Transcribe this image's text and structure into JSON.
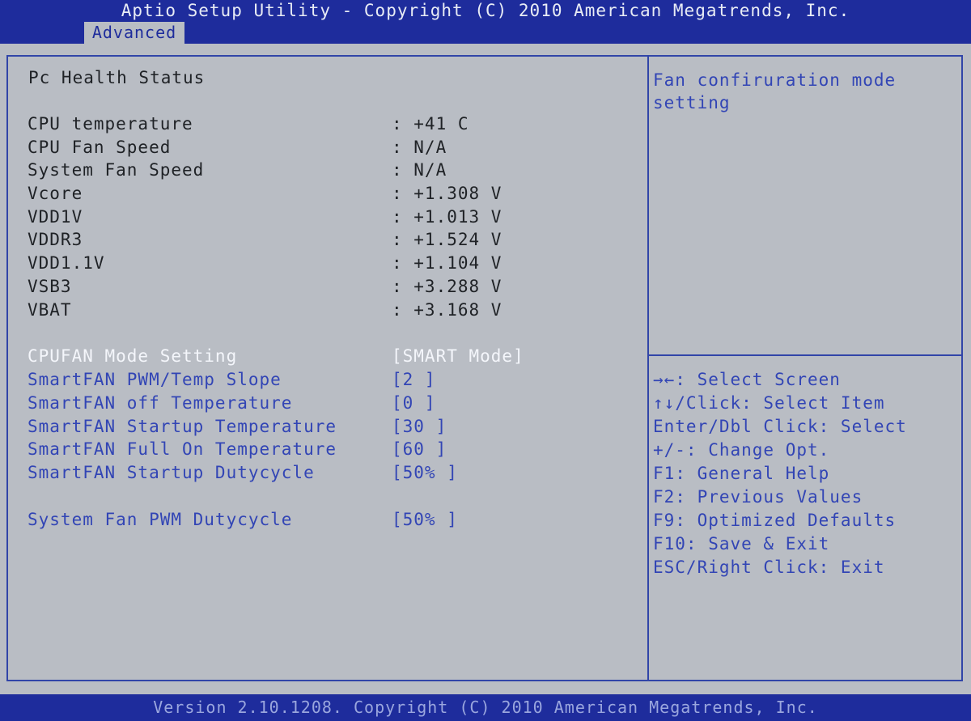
{
  "header": {
    "title": "Aptio Setup Utility - Copyright (C) 2010 American Megatrends, Inc.",
    "active_tab": "Advanced"
  },
  "main": {
    "section_title": "Pc Health Status",
    "readings": [
      {
        "label": "CPU temperature",
        "value": ": +41 C"
      },
      {
        "label": "CPU Fan Speed",
        "value": ": N/A"
      },
      {
        "label": "System Fan Speed",
        "value": ": N/A"
      },
      {
        "label": "Vcore",
        "value": ": +1.308 V"
      },
      {
        "label": "VDD1V",
        "value": ": +1.013 V"
      },
      {
        "label": "VDDR3",
        "value": ": +1.524 V"
      },
      {
        "label": "VDD1.1V",
        "value": ": +1.104 V"
      },
      {
        "label": "VSB3",
        "value": ": +3.288 V"
      },
      {
        "label": "VBAT",
        "value": ": +3.168 V"
      }
    ],
    "settings": [
      {
        "label": "CPUFAN Mode Setting",
        "value": "[SMART Mode]",
        "selected": true
      },
      {
        "label": "SmartFAN PWM/Temp Slope",
        "value": "[2 ]"
      },
      {
        "label": "SmartFAN off Temperature",
        "value": "[0 ]"
      },
      {
        "label": "SmartFAN Startup Temperature",
        "value": "[30 ]"
      },
      {
        "label": "SmartFAN Full On Temperature",
        "value": "[60 ]"
      },
      {
        "label": "SmartFAN Startup Dutycycle",
        "value": "[50% ]"
      },
      {
        "label": "System Fan PWM Dutycycle",
        "value": "[50% ]"
      }
    ]
  },
  "help": {
    "description": "Fan confiruration mode setting",
    "keys": [
      "→←: Select Screen",
      "↑↓/Click: Select Item",
      "Enter/Dbl Click: Select",
      "+/-: Change Opt.",
      "F1: General Help",
      "F2: Previous Values",
      "F9: Optimized Defaults",
      "F10: Save & Exit",
      "ESC/Right Click: Exit"
    ]
  },
  "footer": {
    "text": "Version 2.10.1208. Copyright (C) 2010 American Megatrends, Inc."
  },
  "colors": {
    "bar_blue": "#1e2c9c",
    "panel_gray": "#b9bdc4",
    "setting_blue": "#3245b5",
    "selected_white": "#f4f6fb"
  }
}
